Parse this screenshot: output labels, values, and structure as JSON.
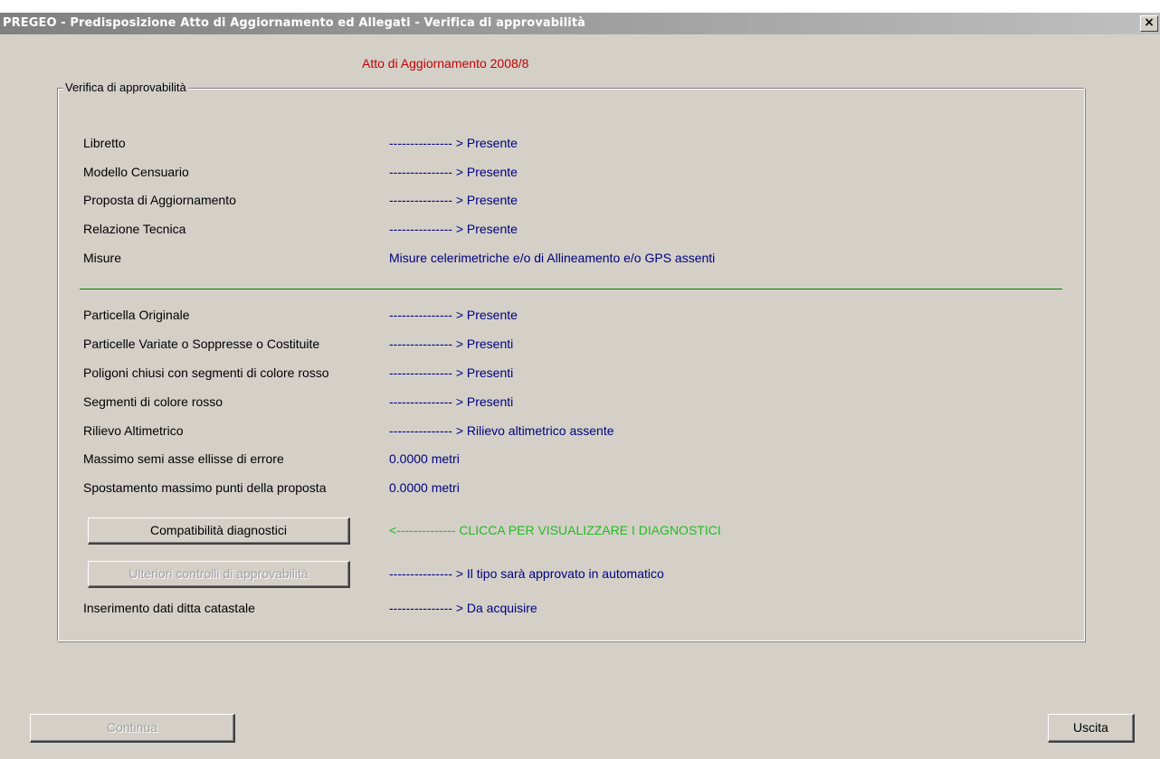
{
  "window": {
    "title": "PREGEO - Predisposizione Atto di Aggiornamento ed Allegati - Verifica di approvabilità",
    "close_glyph": "×"
  },
  "header": {
    "atto": "Atto di Aggiornamento 2008/8"
  },
  "group": {
    "label": "Verifica di approvabilità"
  },
  "section1": [
    {
      "label": "Libretto",
      "value": "--------------- > Presente"
    },
    {
      "label": "Modello Censuario",
      "value": "--------------- > Presente"
    },
    {
      "label": "Proposta di Aggiornamento",
      "value": "--------------- > Presente"
    },
    {
      "label": "Relazione Tecnica",
      "value": "--------------- > Presente"
    },
    {
      "label": "Misure",
      "value": "Misure celerimetriche e/o di Allineamento e/o GPS assenti"
    }
  ],
  "section2": [
    {
      "label": "Particella Originale",
      "value": "--------------- > Presente"
    },
    {
      "label": "Particelle Variate o Soppresse o Costituite",
      "value": "--------------- > Presenti"
    },
    {
      "label": "Poligoni chiusi con segmenti di colore rosso",
      "value": "--------------- > Presenti"
    },
    {
      "label": "Segmenti di colore rosso",
      "value": "--------------- > Presenti"
    },
    {
      "label": "Rilievo Altimetrico",
      "value": "--------------- > Rilievo altimetrico assente"
    },
    {
      "label": "Massimo semi asse ellisse di errore",
      "value": "0.0000  metri"
    },
    {
      "label": "Spostamento massimo punti della proposta",
      "value": "0.0000 metri"
    }
  ],
  "diagnostics": {
    "button_label": "Compatibilità diagnostici",
    "hint": "<-------------- CLICCA PER VISUALIZZARE I DIAGNOSTICI"
  },
  "further_checks": {
    "button_label": "Ulteriori controlli di approvabilità",
    "status": "--------------- > Il tipo sarà approvato in automatico"
  },
  "ditta": {
    "label": "Inserimento dati ditta catastale",
    "status": "--------------- > Da acquisire"
  },
  "footer": {
    "continue_label": "Continua",
    "exit_label": "Uscita"
  },
  "colors": {
    "window_bg": "#d4d0c8",
    "value_text": "#000080",
    "atto_text": "#c00000",
    "hint_text": "#22bb22",
    "separator": "#008000"
  }
}
